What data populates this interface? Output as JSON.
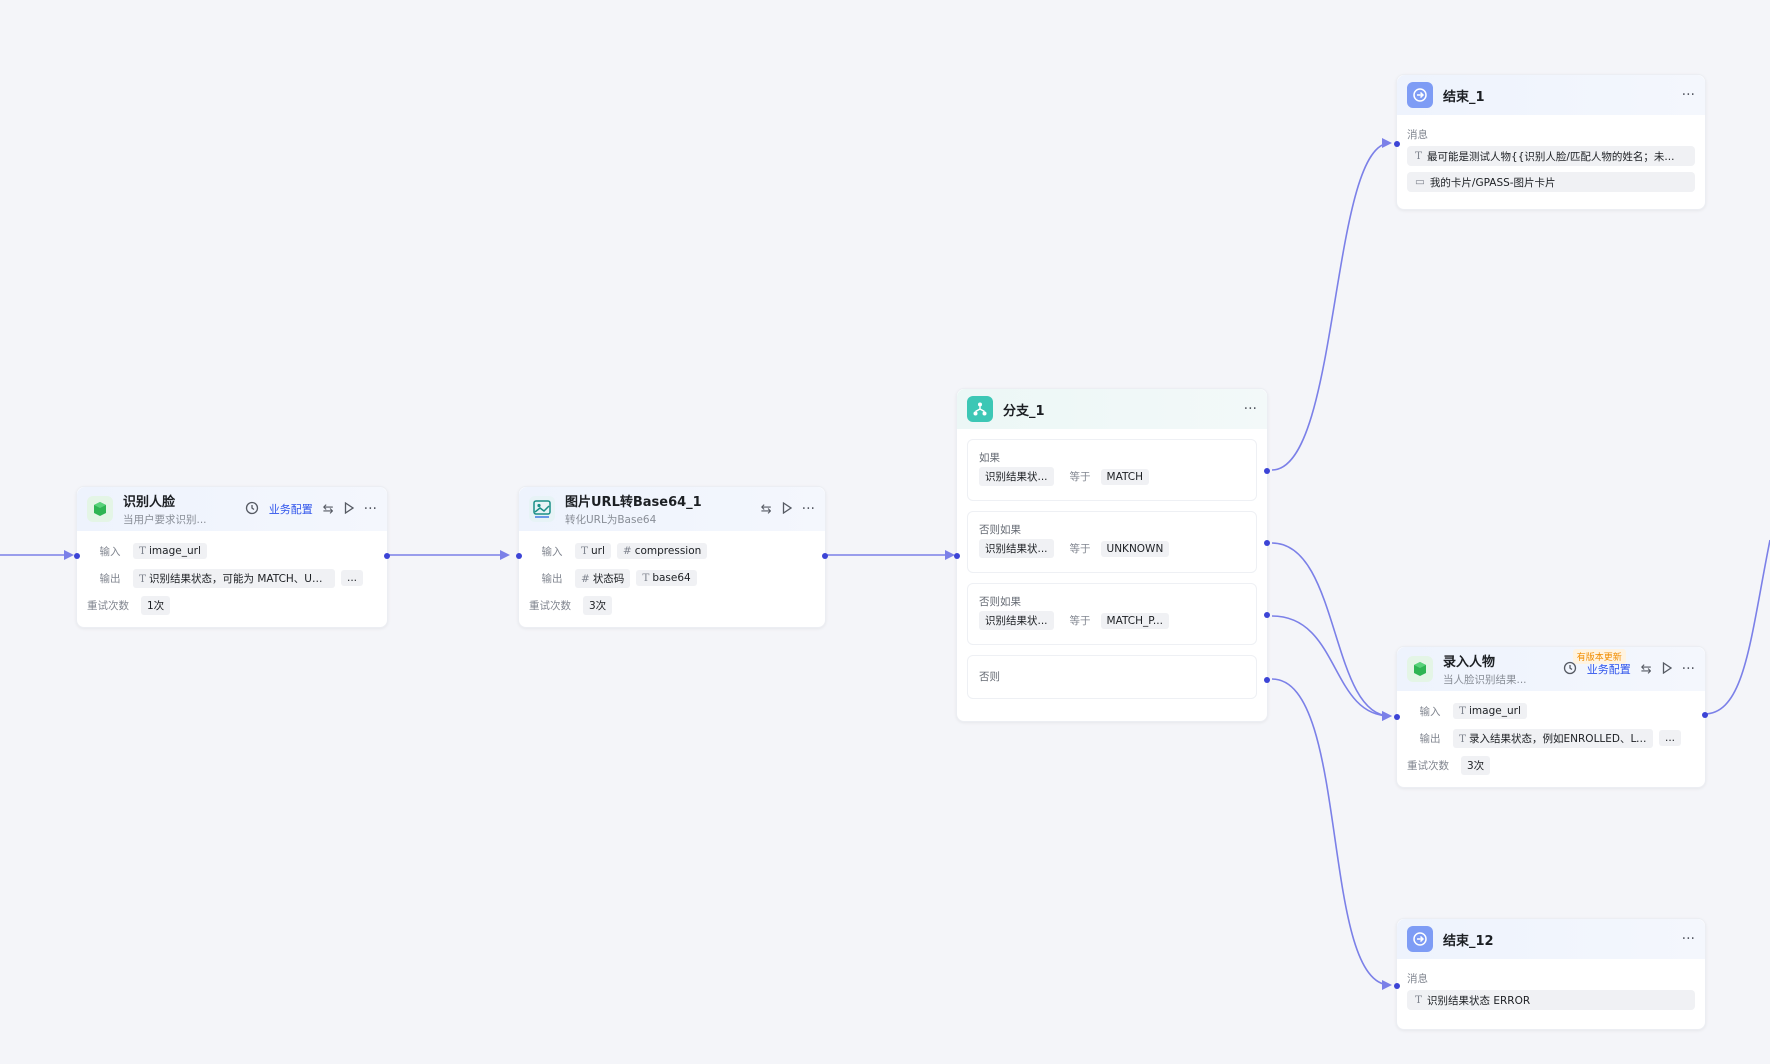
{
  "nodes": {
    "face_recognize": {
      "title": "识别人脸",
      "subtitle": "当用户要求识别...",
      "config_link": "业务配置",
      "input_label": "输入",
      "input_tag": "image_url",
      "output_label": "输出",
      "output_tag": "识别结果状态，可能为 MATCH、UNKNOWN",
      "output_more": "...",
      "retry_label": "重试次数",
      "retry_value": "1次"
    },
    "url_to_base64": {
      "title": "图片URL转Base64_1",
      "subtitle": "转化URL为Base64",
      "input_label": "输入",
      "input_tags": [
        "url",
        "compression"
      ],
      "output_label": "输出",
      "output_tags": [
        "状态码",
        "base64"
      ],
      "retry_label": "重试次数",
      "retry_value": "3次"
    },
    "branch": {
      "title": "分支_1",
      "conditions": [
        {
          "label": "如果",
          "field": "识别结果状...",
          "op": "等于",
          "value": "MATCH"
        },
        {
          "label": "否则如果",
          "field": "识别结果状...",
          "op": "等于",
          "value": "UNKNOWN"
        },
        {
          "label": "否则如果",
          "field": "识别结果状...",
          "op": "等于",
          "value": "MATCH_P..."
        }
      ],
      "else_label": "否则"
    },
    "end_1": {
      "title": "结束_1",
      "msg_label": "消息",
      "messages": [
        "最可能是测试人物{{识别人脸/匹配人物的姓名；未...",
        "我的卡片/GPASS-图片卡片"
      ]
    },
    "enroll": {
      "title": "录入人物",
      "subtitle": "当人脸识别结果...",
      "badge": "有版本更新",
      "config_link": "业务配置",
      "input_label": "输入",
      "input_tag": "image_url",
      "output_label": "输出",
      "output_tag": "录入结果状态，例如ENROLLED、LOW",
      "output_more": "...",
      "retry_label": "重试次数",
      "retry_value": "3次"
    },
    "end_12": {
      "title": "结束_12",
      "msg_label": "消息",
      "messages": [
        "识别结果状态 ERROR"
      ]
    }
  },
  "colors": {
    "edge": "#7b80e8",
    "port": "#3c44d6",
    "link": "#2f54eb",
    "badge": "#f08c00"
  },
  "icons": [
    "history-icon",
    "switch-icon",
    "play-icon",
    "more-icon",
    "exit-icon",
    "branch-icon",
    "image-convert-icon",
    "plugin-icon",
    "card-icon",
    "text-type-icon",
    "number-type-icon"
  ]
}
